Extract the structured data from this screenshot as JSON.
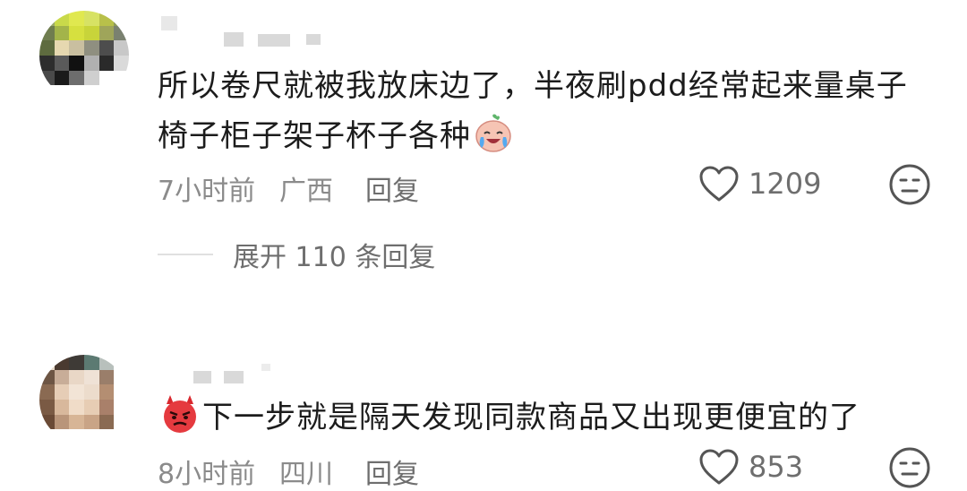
{
  "comments": [
    {
      "text": "所以卷尺就被我放床边了，半夜刷pdd经常起来量桌子椅子柜子架子杯子各种",
      "emoji": "crying-laughing-peach-emoji",
      "time": "7小时前",
      "region": "广西",
      "reply_label": "回复",
      "like_count": "1209",
      "expand_label": "展开 110 条回复"
    },
    {
      "emoji": "angry-devil-emoji",
      "text": "下一步就是隔天发现同款商品又出现更便宜的了",
      "time": "8小时前",
      "region": "四川",
      "reply_label": "回复",
      "like_count": "853"
    }
  ],
  "icons": {
    "like": "heart-outline-icon",
    "dislike": "unamused-face-icon"
  },
  "colors": {
    "text": "#1c1c1c",
    "meta": "#8b8b8b",
    "secondary": "#6e6e6e",
    "blur": "#d9d9d9"
  }
}
